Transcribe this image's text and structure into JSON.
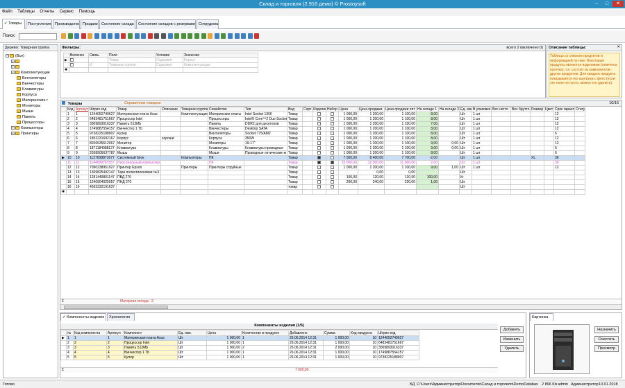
{
  "window": {
    "title": "Склад и торговля (2.916 демо) © Prostoysoft"
  },
  "menu": [
    "Файл",
    "Таблицы",
    "Отчеты",
    "Сервис",
    "Помощь"
  ],
  "tabs": [
    "Товары",
    "Поступления",
    "Производство",
    "Продажи",
    "Состояние склада",
    "Состояние складов с резервами",
    "Сотрудники"
  ],
  "search": {
    "label": "Поиск:",
    "value": ""
  },
  "tree": {
    "header": "Дерево: Товарная группа",
    "items": [
      {
        "label": "(Все)",
        "level": 0,
        "exp": "−"
      },
      {
        "label": "",
        "level": 1,
        "exp": "+"
      },
      {
        "label": "",
        "level": 1,
        "exp": "+"
      },
      {
        "label": "Комплектующие",
        "level": 1,
        "exp": "−"
      },
      {
        "label": "Вентиляторы",
        "level": 2
      },
      {
        "label": "Винчестеры",
        "level": 2
      },
      {
        "label": "Клавиатуры",
        "level": 2
      },
      {
        "label": "Корпуса",
        "level": 2
      },
      {
        "label": "Материнские г",
        "level": 2
      },
      {
        "label": "Мониторы",
        "level": 2
      },
      {
        "label": "Мыши",
        "level": 2
      },
      {
        "label": "Память",
        "level": 2
      },
      {
        "label": "Процессоры",
        "level": 2
      },
      {
        "label": "Компьютеры",
        "level": 1,
        "exp": "+"
      },
      {
        "label": "Принтеры",
        "level": 1,
        "exp": "+"
      }
    ]
  },
  "filters": {
    "title": "Фильтры:",
    "summary": "всего 2 (включено 0)",
    "cols": [
      "Включен",
      "Связь",
      "Поле",
      "Условие",
      "Значение"
    ],
    "rows": [
      [
        "",
        "",
        "Товар",
        "Содержит",
        "Корпус"
      ],
      [
        "",
        "И",
        "Товарная группа",
        "Содержит",
        "Комплектующие"
      ]
    ]
  },
  "description": {
    "title": "Описание таблицы:",
    "text": "Таблица со списком продуктов и информацией по ним. Некоторые продукты являются изделиями (отмечена галочка), т.е. состоят из компонентов - других продуктов. Для каждого продукта показывается его картинка с фото (если это поле не пусто, можно его удалить)."
  },
  "grid": {
    "title": "Товары",
    "subtitle": "Справочник товаров",
    "counter": "10/16",
    "cols": [
      "Код",
      "Артикул",
      "Штрих код",
      "Товар",
      "Описание",
      "Товарная группа",
      "Семейство",
      "Тип",
      "Вид",
      "Сорт",
      "Изделие",
      "Набор",
      "Цена",
      "Цена продажи",
      "Цена продажи опт",
      "На складе 1",
      "На складе 2",
      "Ед. изм",
      "В упаковке",
      "Вес нетто",
      "Вес брутто",
      "Размер",
      "Цвет",
      "Срок гарантии",
      "Статус"
    ],
    "rows": [
      [
        "1",
        "1",
        "1244052749627",
        "Материнская плата Asus",
        "",
        "Комплектующие",
        "Материнские платы",
        "Intel Socket 1366",
        "Товар",
        "",
        "0",
        "0",
        "1 000,00",
        "1 200,00",
        "1 100,00",
        "8,00",
        "",
        "Шт",
        "1 шт",
        "",
        "",
        "",
        "",
        "12",
        ""
      ],
      [
        "2",
        "2",
        "6483481751667",
        "Процессор Intel",
        "",
        "",
        "Процессоры",
        "Intel® Core™2 Duo Socket",
        "Товар",
        "",
        "0",
        "0",
        "1 000,00",
        "1 200,00",
        "1 100,00",
        "8,00",
        "",
        "Шт",
        "1 шт",
        "",
        "",
        "",
        "",
        "12",
        ""
      ],
      [
        "3",
        "3",
        "3009893016337",
        "Память 512Mb",
        "",
        "",
        "Память",
        "DDR2 для десктопов",
        "Товар",
        "",
        "0",
        "0",
        "1 000,00",
        "1 200,00",
        "1 100,00",
        "7,00",
        "",
        "Шт",
        "1 шт",
        "",
        "",
        "",
        "",
        "12",
        ""
      ],
      [
        "4",
        "4",
        "1749887554157",
        "Винчестер 1 Tb",
        "",
        "",
        "Винчестеры",
        "Desktop SATA",
        "Товар",
        "",
        "0",
        "0",
        "1 000,00",
        "1 200,00",
        "1 100,00",
        "8,00",
        "",
        "Шт",
        "1 шт",
        "",
        "",
        "",
        "",
        "12",
        ""
      ],
      [
        "5",
        "5",
        "9738225188907",
        "Кулер",
        "",
        "",
        "Вентиляторы",
        "Socket 775/AM2",
        "Товар",
        "",
        "0",
        "0",
        "1 000,00",
        "1 200,00",
        "1 100,00",
        "8,00",
        "",
        "Шт",
        "1 шт",
        "",
        "",
        "",
        "",
        "6",
        ""
      ],
      [
        "6",
        "6",
        "1852231692167",
        "Корпус",
        "хороши",
        "",
        "Корпуса",
        "350W",
        "Товар",
        "",
        "0",
        "0",
        "1 000,00",
        "1 200,00",
        "1 100,00",
        "8,00",
        "",
        "Шт",
        "1 шт",
        "",
        "",
        "",
        "",
        "12",
        ""
      ],
      [
        "7",
        "7",
        "8026635512067",
        "Монитор",
        "",
        "",
        "Мониторы",
        "19-17\"",
        "Товар",
        "",
        "0",
        "0",
        "1 000,00",
        "1 200,00",
        "1 100,00",
        "9,00",
        "0,00",
        "Шт",
        "1 шт",
        "",
        "",
        "",
        "",
        "12",
        ""
      ],
      [
        "8",
        "8",
        "1871184088127",
        "Клавиатура",
        "",
        "",
        "Клавиатуры",
        "Клавиатуры проводные",
        "Товар",
        "",
        "0",
        "0",
        "1 000,00",
        "1 200,00",
        "1 100,00",
        "9,00",
        "0,00",
        "Шт",
        "1 шт",
        "",
        "",
        "",
        "",
        "6",
        ""
      ],
      [
        "9",
        "9",
        "2038905637787",
        "Мышь",
        "",
        "",
        "Мыши",
        "Проводные оптические м",
        "Товар",
        "",
        "0",
        "0",
        "1 000,00",
        "1 200,00",
        "1 100,00",
        "8,00",
        "",
        "Шт",
        "1 шт",
        "",
        "",
        "",
        "",
        "6",
        ""
      ],
      [
        "10",
        "10",
        "1127008871677",
        "Системный блок",
        "",
        "Компьютеры",
        "ПК",
        "",
        "Товар",
        "",
        "1",
        "0",
        "7 000,00",
        "8 400,00",
        "7 700,00",
        "-2,00",
        "",
        "Шт",
        "1 шт",
        "",
        "",
        "XL",
        "",
        "36",
        ""
      ],
      [
        "11",
        "11",
        "1144898767557",
        "Персональный компьютер",
        "",
        "",
        "ПК",
        "",
        "Товар",
        "",
        "1",
        "1",
        "10 000,00",
        "12 000,00",
        "11 000,00",
        "2,00",
        "",
        "Шт",
        "1 шт",
        "",
        "",
        "",
        "",
        "36",
        ""
      ],
      [
        "12",
        "12",
        "7090238951927",
        "Принтер Epson",
        "",
        "Принтеры",
        "Принтеры струйные",
        "",
        "Товар",
        "",
        "0",
        "0",
        "1 000,00",
        "1 200,00",
        "1 100,00",
        "9,00",
        "1,00",
        "Шт",
        "1 шт",
        "",
        "",
        "",
        "",
        "12",
        ""
      ],
      [
        "13",
        "13",
        "1369825492147",
        "Тара полиэтиленовая №3",
        "",
        "",
        "",
        "",
        "Товар",
        "",
        "0",
        "0",
        "",
        "0,00",
        "0,00",
        "",
        "",
        "Шт",
        "",
        "",
        "",
        "",
        "",
        "",
        ""
      ],
      [
        "14",
        "14",
        "1281449801147",
        "ПВД 270",
        "",
        "",
        "",
        "",
        "Товар",
        "",
        "0",
        "0",
        "100,00",
        "120,00",
        "110,00",
        "100,00",
        "",
        "Кг",
        "",
        "",
        "",
        "",
        "",
        "",
        ""
      ],
      [
        "15",
        "15",
        "1240904025957",
        "ПНД 270",
        "",
        "",
        "",
        "",
        "Товар",
        "",
        "0",
        "0",
        "200,00",
        "240,00",
        "220,00",
        "1,00",
        "",
        "Шт",
        "",
        "",
        "",
        "",
        "",
        "",
        ""
      ],
      [
        "16",
        "16",
        "4563332191637",
        "",
        "",
        "",
        "",
        "",
        "товар",
        "",
        "0",
        "0",
        "",
        "",
        "",
        "",
        "",
        "Шт",
        "",
        "",
        "",
        "",
        "",
        "",
        ""
      ]
    ],
    "footer": "Материал склада: -2"
  },
  "bottom": {
    "tabs": [
      "Компоненты изделия",
      "Хронология"
    ],
    "title": "Компоненты изделия (1/5)",
    "cols": [
      "№",
      "Код компонента",
      "Артикул",
      "Компонент",
      "Ед. изм.",
      "Цена",
      "Количество в продукте",
      "Добавлено",
      "Сумма",
      "Код продукта",
      "Штрих-код"
    ],
    "rows": [
      [
        "1",
        "1",
        "1",
        "Материнская плата Asus",
        "Шт",
        "1 000,00",
        "1",
        "26.06.2014 12:31",
        "1 000,00",
        "10",
        "1244052749627"
      ],
      [
        "2",
        "2",
        "2",
        "Процессор Intel",
        "Шт",
        "1 000,00",
        "1",
        "26.06.2014 12:31",
        "1 000,00",
        "10",
        "6483481751667"
      ],
      [
        "3",
        "3",
        "3",
        "Память 512Mb",
        "Шт",
        "1 000,00",
        "2",
        "26.06.2014 12:31",
        "2 000,00",
        "10",
        "3009893016337"
      ],
      [
        "4",
        "4",
        "4",
        "Винчестер 1 Tb",
        "Шт",
        "1 000,00",
        "1",
        "26.06.2014 12:31",
        "1 000,00",
        "10",
        "1749887554157"
      ],
      [
        "5",
        "5",
        "5",
        "Кулер",
        "Шт",
        "1 000,00",
        "1",
        "26.06.2014 12:31",
        "1 000,00",
        "10",
        "9738225188907"
      ]
    ],
    "total": "7 000,00",
    "buttons": [
      "Добавить",
      "Изменить",
      "Удалить"
    ]
  },
  "image": {
    "title": "Картинка",
    "buttons": [
      "Назначить",
      "Очистить",
      "Просмотр"
    ]
  },
  "status": {
    "left": "Готово",
    "db": "БД",
    "path": "C:\\Users\\Администратор\\Documents\\Склад и торговля\\DemoDatabase.mdb",
    "size": "2 896 Kb",
    "user": "admin",
    "role": "Администратор",
    "date": "10.01.2018"
  },
  "colors": {
    "titlebar": "#2b8fc4",
    "close": "#c7372b",
    "green": "#d7f2d0",
    "selected": "#c9ddf5",
    "pink": "#d04cd0",
    "note_bg": "#fff5c8"
  }
}
